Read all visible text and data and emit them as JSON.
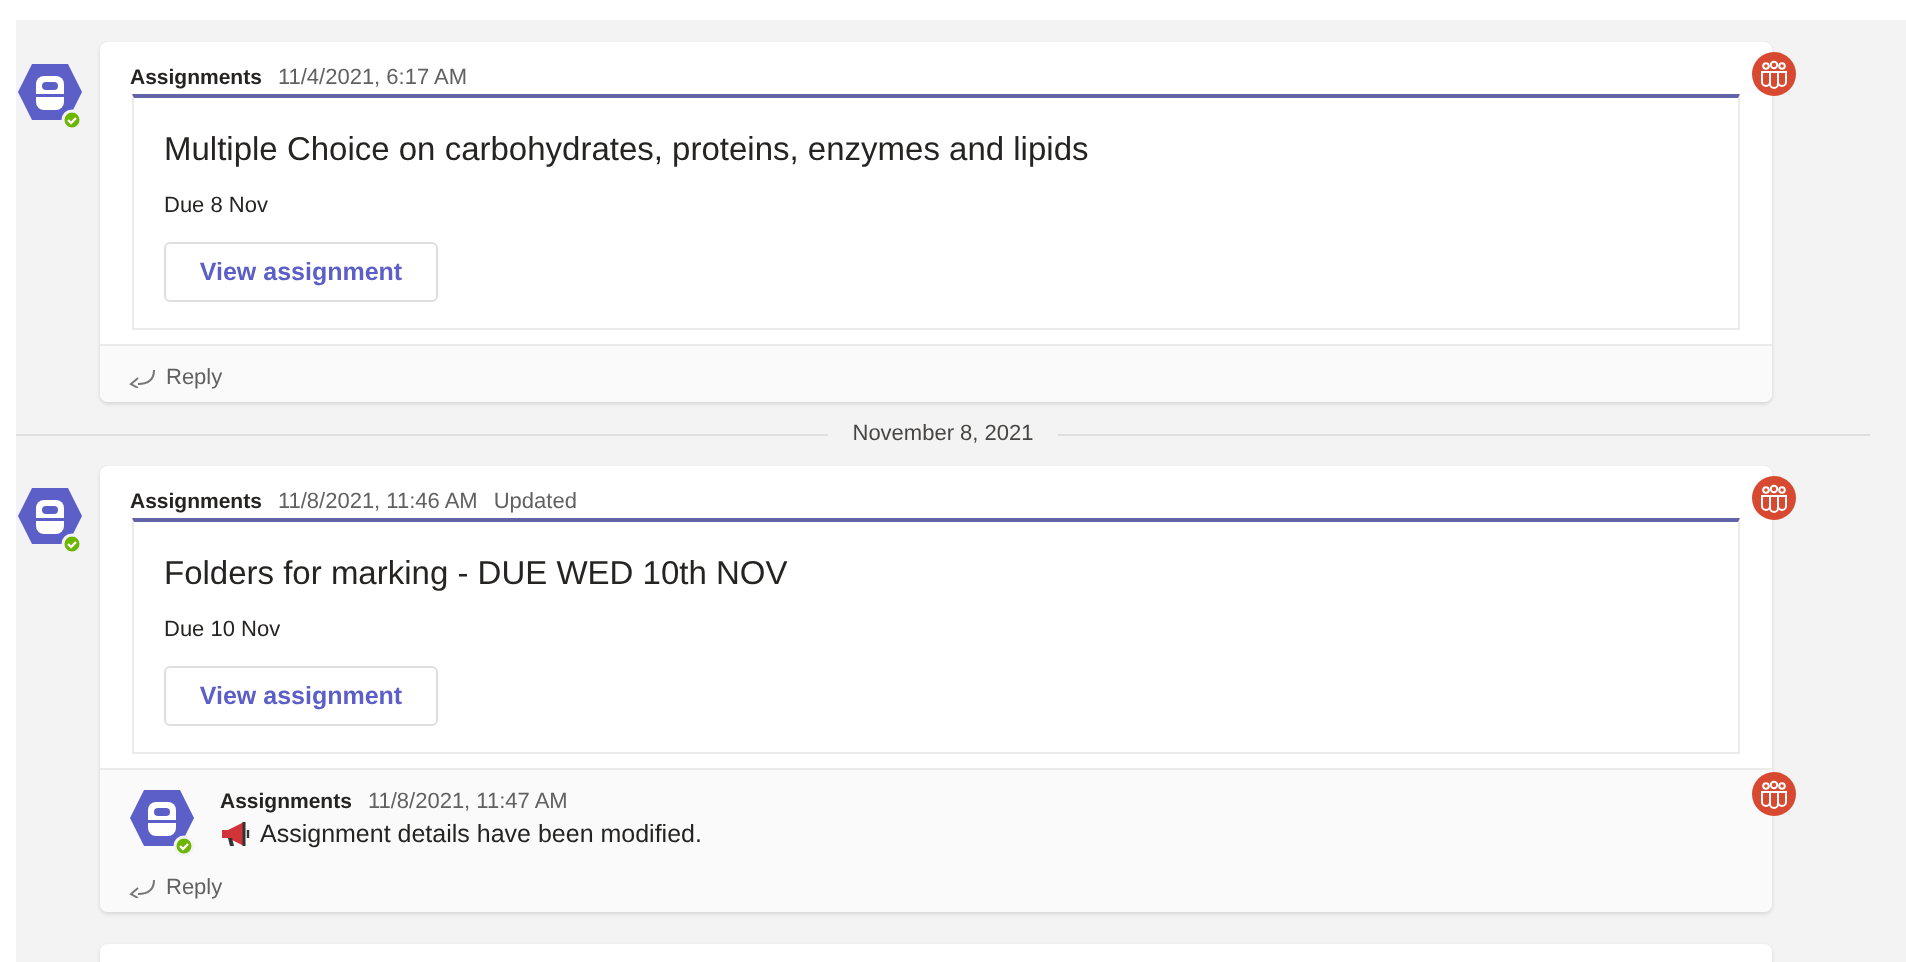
{
  "feed": [
    {
      "kind": "thread",
      "sender": "Assignments",
      "time": "11/4/2021, 6:17 AM",
      "title": "Multiple Choice on carbohydrates, proteins, enzymes and lipids",
      "due": "Due 8 Nov",
      "button": "View assignment",
      "reply_label": "Reply"
    },
    {
      "kind": "date",
      "label": "November 8, 2021"
    },
    {
      "kind": "thread",
      "sender": "Assignments",
      "time": "11/8/2021, 11:46 AM",
      "status": "Updated",
      "title": "Folders for marking - DUE WED 10th NOV",
      "due": "Due 10 Nov",
      "button": "View assignment",
      "replies": [
        {
          "sender": "Assignments",
          "time": "11/8/2021, 11:47 AM",
          "text": "Assignment details have been modified."
        }
      ],
      "reply_label": "Reply"
    },
    {
      "kind": "cut_card"
    }
  ]
}
